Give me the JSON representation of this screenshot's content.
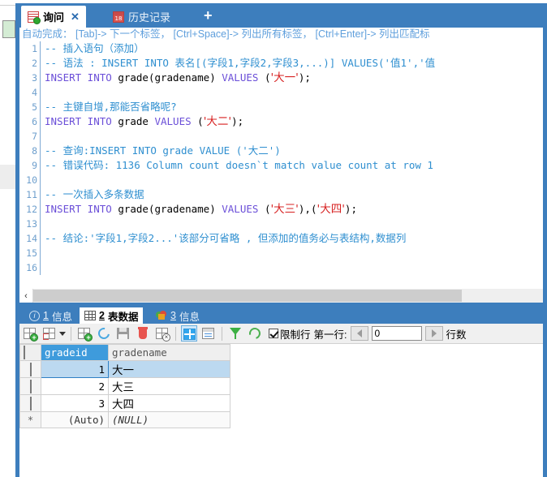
{
  "editor_tabs": [
    {
      "label": "询问",
      "icon": "query-icon",
      "active": true,
      "close": "✕"
    },
    {
      "label": "历史记录",
      "icon": "calendar-icon",
      "calendar_day": "18",
      "active": false
    }
  ],
  "new_tab_label": "+",
  "editor": {
    "hint": "自动完成： [Tab]-> 下一个标签， [Ctrl+Space]-> 列出所有标签， [Ctrl+Enter]-> 列出匹配标",
    "line_numbers": [
      "1",
      "2",
      "3",
      "4",
      "5",
      "6",
      "7",
      "8",
      "9",
      "10",
      "11",
      "12",
      "13",
      "14",
      "15",
      "16"
    ],
    "lines": [
      {
        "n": "1",
        "segments": [
          {
            "t": "comment",
            "s": "-- 插入语句（添加）"
          }
        ]
      },
      {
        "n": "2",
        "segments": [
          {
            "t": "comment",
            "s": "-- 语法 : INSERT INTO 表名[(字段1,字段2,字段3,...)] VALUES('值1','值"
          }
        ]
      },
      {
        "n": "3",
        "segments": [
          {
            "t": "keyword",
            "s": "INSERT INTO "
          },
          {
            "t": "ident",
            "s": "grade(gradename) "
          },
          {
            "t": "keyword",
            "s": "VALUES "
          },
          {
            "t": "punct",
            "s": "("
          },
          {
            "t": "string",
            "s": "'大一'"
          },
          {
            "t": "punct",
            "s": ");"
          }
        ]
      },
      {
        "n": "4",
        "segments": []
      },
      {
        "n": "5",
        "segments": [
          {
            "t": "comment",
            "s": "-- 主键自增,那能否省略呢?"
          }
        ]
      },
      {
        "n": "6",
        "segments": [
          {
            "t": "keyword",
            "s": "INSERT INTO "
          },
          {
            "t": "ident",
            "s": "grade "
          },
          {
            "t": "keyword",
            "s": "VALUES "
          },
          {
            "t": "punct",
            "s": "("
          },
          {
            "t": "string",
            "s": "'大二'"
          },
          {
            "t": "punct",
            "s": ");"
          }
        ]
      },
      {
        "n": "7",
        "segments": []
      },
      {
        "n": "8",
        "segments": [
          {
            "t": "comment",
            "s": "-- 查询:INSERT INTO grade VALUE ('大二')"
          }
        ]
      },
      {
        "n": "9",
        "segments": [
          {
            "t": "comment",
            "s": "-- 错误代码: 1136 Column count doesn`t match value count at row 1"
          }
        ]
      },
      {
        "n": "10",
        "segments": []
      },
      {
        "n": "11",
        "segments": [
          {
            "t": "comment",
            "s": "-- 一次插入多条数据"
          }
        ]
      },
      {
        "n": "12",
        "segments": [
          {
            "t": "keyword",
            "s": "INSERT INTO "
          },
          {
            "t": "ident",
            "s": "grade(gradename) "
          },
          {
            "t": "keyword",
            "s": "VALUES "
          },
          {
            "t": "punct",
            "s": "("
          },
          {
            "t": "string",
            "s": "'大三'"
          },
          {
            "t": "punct",
            "s": "),("
          },
          {
            "t": "string",
            "s": "'大四'"
          },
          {
            "t": "punct",
            "s": ");"
          }
        ]
      },
      {
        "n": "13",
        "segments": []
      },
      {
        "n": "14",
        "segments": [
          {
            "t": "comment",
            "s": "-- 结论:'字段1,字段2...'该部分可省略 , 但添加的值务必与表结构,数据列"
          }
        ]
      },
      {
        "n": "15",
        "segments": []
      },
      {
        "n": "16",
        "segments": []
      }
    ]
  },
  "h_scroll": {
    "left_arrow": "‹"
  },
  "result_tabs": [
    {
      "num": "1",
      "label": "信息",
      "icon": "info-icon",
      "active": false
    },
    {
      "num": "2",
      "label": "表数据",
      "icon": "table-icon",
      "active": true
    },
    {
      "num": "3",
      "label": "信息",
      "icon": "chart-icon",
      "active": false
    }
  ],
  "grid_toolbar": {
    "buttons": [
      {
        "name": "add-record-button",
        "icon": "grid-plus-icon"
      },
      {
        "name": "record-options-button",
        "icon": "grid-dashed-icon",
        "has_caret": true
      },
      {
        "name": "insert-record-button",
        "icon": "grid-plus-icon"
      },
      {
        "name": "refresh-record-button",
        "icon": "refresh-blue-icon"
      },
      {
        "name": "save-record-button",
        "icon": "save-icon"
      },
      {
        "name": "delete-record-button",
        "icon": "trash-icon"
      },
      {
        "name": "cancel-record-button",
        "icon": "grid-cancel-icon"
      },
      {
        "name": "grid-view-button",
        "icon": "blue-grid-icon",
        "selected": true
      },
      {
        "name": "form-view-button",
        "icon": "form-icon"
      },
      {
        "name": "filter-button",
        "icon": "funnel-icon"
      },
      {
        "name": "refresh-button",
        "icon": "refresh-green-icon"
      }
    ],
    "limit_rows_label": "限制行",
    "limit_rows_checked": true,
    "first_row_label": "第一行:",
    "first_row_value": "0",
    "row_count_label": "行数"
  },
  "data_grid": {
    "columns": [
      "",
      "gradeid",
      "gradename"
    ],
    "highlight_column": "gradeid",
    "rows": [
      {
        "selected": true,
        "id": "1",
        "name": "大一"
      },
      {
        "selected": false,
        "id": "2",
        "name": "大三"
      },
      {
        "selected": false,
        "id": "3",
        "name": "大四"
      }
    ],
    "new_row": {
      "marker": "*",
      "id": "(Auto)",
      "name": "(NULL)"
    }
  },
  "colors": {
    "chrome_blue": "#3d7ebd",
    "accent_blue": "#3e9bdc",
    "comment": "#2f8fd0",
    "keyword": "#6b4fd8",
    "string": "#d72020",
    "selection": "#bcd9f0",
    "cell_green": "#d4ecd4"
  }
}
